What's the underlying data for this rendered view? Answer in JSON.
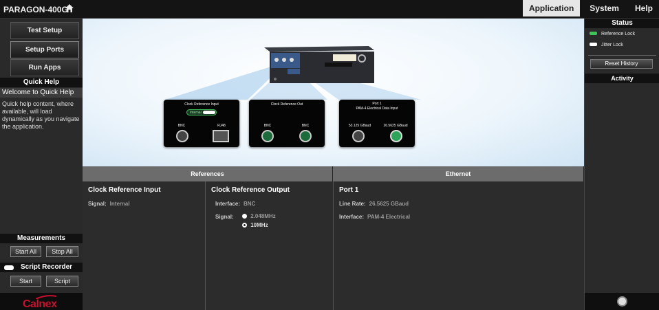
{
  "header": {
    "app_title": "PARAGON-400G",
    "nav": [
      "Application",
      "System",
      "Help"
    ]
  },
  "left": {
    "nav_buttons": [
      "Test Setup",
      "Setup Ports",
      "Run Apps"
    ],
    "quick_help_header": "Quick Help",
    "quick_help_title": "Welcome to Quick Help",
    "quick_help_body": "Quick help content, where available, will load dynamically as you navigate the application.",
    "measurements_header": "Measurements",
    "start_all": "Start All",
    "stop_all": "Stop All",
    "script_recorder_header": "Script Recorder",
    "start": "Start",
    "script": "Script",
    "logo": "Calnex"
  },
  "diagram": {
    "card1": {
      "title": "Clock Reference Input",
      "toggle": "Internal",
      "port_labels": [
        "BNC",
        "RJ48"
      ]
    },
    "card2": {
      "title": "Clock Reference Out",
      "port_labels": [
        "BNC",
        "BNC"
      ]
    },
    "card3": {
      "title": "Port 1",
      "subtitle": "PAM-4 Electrical Data Input",
      "port_labels": [
        "53.125 GBaud",
        "26.5625 GBaud"
      ]
    }
  },
  "tabs": [
    "References",
    "Ethernet"
  ],
  "details": {
    "clock_ref_input": {
      "title": "Clock Reference Input",
      "signal_label": "Signal:",
      "signal_value": "Internal"
    },
    "clock_ref_output": {
      "title": "Clock Reference Output",
      "interface_label": "Interface:",
      "interface_value": "BNC",
      "signal_label": "Signal:",
      "options": [
        "2.048MHz",
        "10MHz"
      ],
      "selected": "10MHz"
    },
    "port1": {
      "title": "Port 1",
      "line_rate_label": "Line Rate:",
      "line_rate_value": "26.5625 GBaud",
      "interface_label": "Interface:",
      "interface_value": "PAM-4 Electrical"
    }
  },
  "right": {
    "status_header": "Status",
    "reference_lock": "Reference Lock",
    "jitter_lock": "Jitter Lock",
    "reset_history": "Reset History",
    "activity_header": "Activity"
  },
  "colors": {
    "led_green": "#3ec25c",
    "led_white": "#ffffff",
    "brand_red": "#c8102e"
  }
}
